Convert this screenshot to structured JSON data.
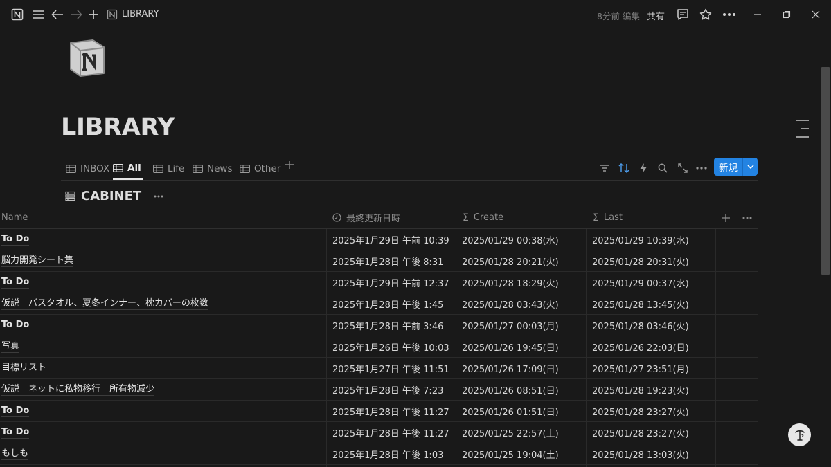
{
  "titlebar": {
    "title": "LIBRARY",
    "edited": "8分前 編集",
    "share": "共有"
  },
  "page": {
    "title": "LIBRARY"
  },
  "tabs": [
    {
      "label": "INBOX"
    },
    {
      "label": "All"
    },
    {
      "label": "Life"
    },
    {
      "label": "News"
    },
    {
      "label": "Other"
    }
  ],
  "toolbar": {
    "new_label": "新規"
  },
  "database": {
    "title": "CABINET"
  },
  "table": {
    "columns": [
      "Name",
      "最終更新日時",
      "Create",
      "Last"
    ],
    "rows": [
      {
        "name": "To Do",
        "modified": "2025年1月29日 午前 10:39",
        "create": "2025/01/29 00:38(水)",
        "last": "2025/01/29 10:39(水)"
      },
      {
        "name": "脳力開発シート集",
        "modified": "2025年1月28日 午後 8:31",
        "create": "2025/01/28 20:21(火)",
        "last": "2025/01/28 20:31(火)"
      },
      {
        "name": "To Do",
        "modified": "2025年1月29日 午前 12:37",
        "create": "2025/01/28 18:29(火)",
        "last": "2025/01/29 00:37(水)"
      },
      {
        "name": "仮説　バスタオル、夏冬インナー、枕カバーの枚数",
        "modified": "2025年1月28日 午後 1:45",
        "create": "2025/01/28 03:43(火)",
        "last": "2025/01/28 13:45(火)"
      },
      {
        "name": "To Do",
        "modified": "2025年1月28日 午前 3:46",
        "create": "2025/01/27 00:03(月)",
        "last": "2025/01/28 03:46(火)"
      },
      {
        "name": "写真",
        "modified": "2025年1月26日 午後 10:03",
        "create": "2025/01/26 19:45(日)",
        "last": "2025/01/26 22:03(日)"
      },
      {
        "name": "目標リスト",
        "modified": "2025年1月27日 午後 11:51",
        "create": "2025/01/26 17:09(日)",
        "last": "2025/01/27 23:51(月)"
      },
      {
        "name": "仮説　ネットに私物移行　所有物減少",
        "modified": "2025年1月28日 午後 7:23",
        "create": "2025/01/26 08:51(日)",
        "last": "2025/01/28 19:23(火)"
      },
      {
        "name": "To Do",
        "modified": "2025年1月28日 午後 11:27",
        "create": "2025/01/26 01:51(日)",
        "last": "2025/01/28 23:27(火)"
      },
      {
        "name": "To Do",
        "modified": "2025年1月28日 午後 11:27",
        "create": "2025/01/25 22:57(土)",
        "last": "2025/01/28 23:27(火)"
      },
      {
        "name": "もしも",
        "modified": "2025年1月28日 午後 1:03",
        "create": "2025/01/25 19:04(土)",
        "last": "2025/01/28 13:03(火)"
      }
    ]
  },
  "colors": {
    "accent": "#2383e2",
    "background": "#191919"
  }
}
